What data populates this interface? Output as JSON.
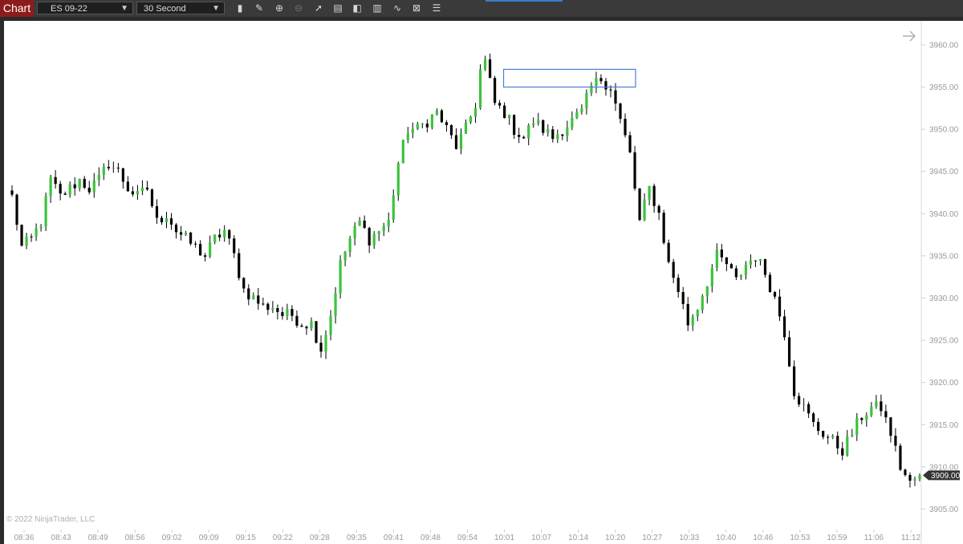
{
  "toolbar": {
    "chart_tab": "Chart",
    "instrument": "ES 09-22",
    "interval": "30 Second",
    "tools": [
      "bar-style-icon",
      "pencil-icon",
      "zoom-in-icon",
      "zoom-out-icon",
      "pointer-icon",
      "data-box-icon",
      "properties-icon",
      "strategies-icon",
      "indicators-icon",
      "templates-icon",
      "object-list-icon"
    ]
  },
  "copyright": "© 2022 NinjaTrader, LLC",
  "price_tag": "3909.00",
  "colors": {
    "up": "#3ec23e",
    "down": "#000000",
    "wick": "#000000",
    "rect": "#4a7fd6",
    "tag": "#333333"
  },
  "chart_data": {
    "type": "candlestick",
    "y_axis": {
      "ticks": [
        "3905.00",
        "3910.00",
        "3915.00",
        "3920.00",
        "3925.00",
        "3930.00",
        "3935.00",
        "3940.00",
        "3945.00",
        "3950.00",
        "3955.00",
        "3960.00"
      ],
      "range": [
        3903,
        3962
      ]
    },
    "x_axis": {
      "ticks": [
        "08:36",
        "08:43",
        "08:49",
        "08:56",
        "09:02",
        "09:09",
        "09:15",
        "09:22",
        "09:28",
        "09:35",
        "09:41",
        "09:48",
        "09:54",
        "10:01",
        "10:07",
        "10:14",
        "10:20",
        "10:27",
        "10:33",
        "10:40",
        "10:46",
        "10:53",
        "10:59",
        "11:06",
        "11:12"
      ]
    },
    "last_price": 3909.0,
    "rectangle": {
      "time_start": "10:01",
      "time_end": "10:25",
      "price_top": 3957.1,
      "price_bottom": 3955.0
    },
    "path": [
      [
        0,
        3942
      ],
      [
        2,
        3936
      ],
      [
        4,
        3937
      ],
      [
        6,
        3939
      ],
      [
        8,
        3944
      ],
      [
        10,
        3942
      ],
      [
        12,
        3943
      ],
      [
        14,
        3944
      ],
      [
        16,
        3943
      ],
      [
        18,
        3944
      ],
      [
        20,
        3946
      ],
      [
        22,
        3945
      ],
      [
        24,
        3943
      ],
      [
        26,
        3942
      ],
      [
        28,
        3943
      ],
      [
        30,
        3939
      ],
      [
        32,
        3940
      ],
      [
        34,
        3938
      ],
      [
        36,
        3937
      ],
      [
        38,
        3936
      ],
      [
        40,
        3935
      ],
      [
        42,
        3937
      ],
      [
        44,
        3938
      ],
      [
        46,
        3935
      ],
      [
        48,
        3931
      ],
      [
        50,
        3930
      ],
      [
        52,
        3929
      ],
      [
        54,
        3929
      ],
      [
        56,
        3928
      ],
      [
        58,
        3928
      ],
      [
        60,
        3927
      ],
      [
        62,
        3927
      ],
      [
        64,
        3924
      ],
      [
        66,
        3928
      ],
      [
        68,
        3934
      ],
      [
        70,
        3937
      ],
      [
        72,
        3939
      ],
      [
        74,
        3937
      ],
      [
        76,
        3938
      ],
      [
        78,
        3939
      ],
      [
        80,
        3946
      ],
      [
        82,
        3950
      ],
      [
        84,
        3950
      ],
      [
        86,
        3951
      ],
      [
        88,
        3952
      ],
      [
        90,
        3950
      ],
      [
        92,
        3948
      ],
      [
        94,
        3950
      ],
      [
        96,
        3953
      ],
      [
        97,
        3957
      ],
      [
        98,
        3958
      ],
      [
        100,
        3953
      ],
      [
        102,
        3952
      ],
      [
        104,
        3950
      ],
      [
        106,
        3949
      ],
      [
        108,
        3951
      ],
      [
        110,
        3950
      ],
      [
        112,
        3949
      ],
      [
        114,
        3950
      ],
      [
        116,
        3951
      ],
      [
        118,
        3952
      ],
      [
        120,
        3955
      ],
      [
        122,
        3956
      ],
      [
        124,
        3955
      ],
      [
        126,
        3951
      ],
      [
        128,
        3947
      ],
      [
        130,
        3939
      ],
      [
        132,
        3943
      ],
      [
        134,
        3940
      ],
      [
        136,
        3934
      ],
      [
        138,
        3931
      ],
      [
        140,
        3927
      ],
      [
        142,
        3929
      ],
      [
        144,
        3932
      ],
      [
        146,
        3935
      ],
      [
        148,
        3934
      ],
      [
        150,
        3932
      ],
      [
        152,
        3934
      ],
      [
        154,
        3935
      ],
      [
        156,
        3933
      ],
      [
        158,
        3930
      ],
      [
        160,
        3926
      ],
      [
        162,
        3919
      ],
      [
        164,
        3917
      ],
      [
        166,
        3915
      ],
      [
        168,
        3914
      ],
      [
        170,
        3913
      ],
      [
        172,
        3912
      ],
      [
        174,
        3914
      ],
      [
        176,
        3916
      ],
      [
        178,
        3917
      ],
      [
        180,
        3917
      ],
      [
        182,
        3914
      ],
      [
        184,
        3910
      ],
      [
        186,
        3908
      ],
      [
        188,
        3909
      ]
    ],
    "candle_count": 189
  }
}
